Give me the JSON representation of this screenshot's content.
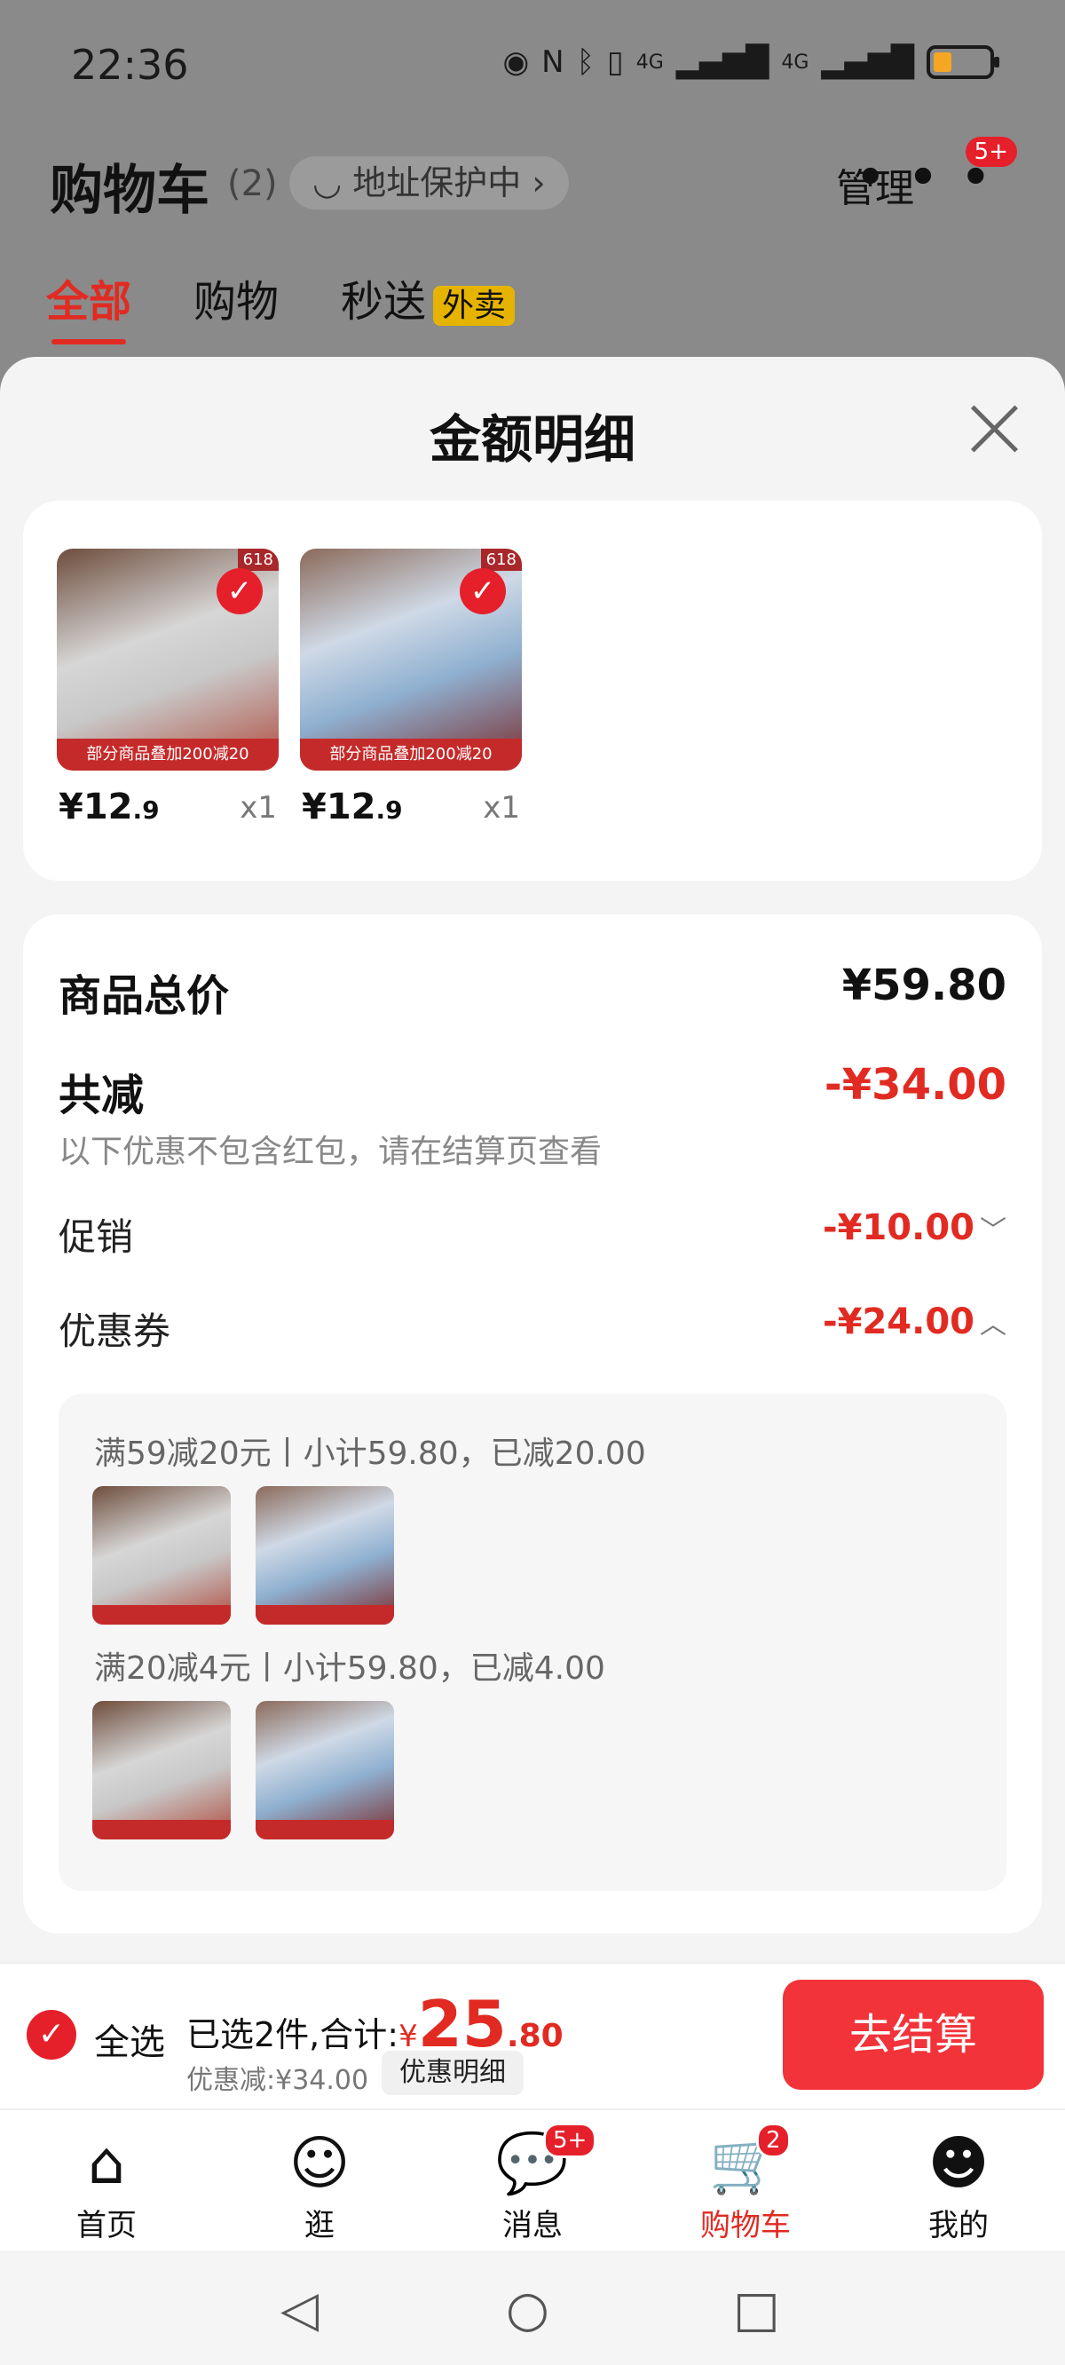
{
  "status_bar": {
    "time": "22:36",
    "network_1": "4G",
    "network_2": "4G",
    "icons": [
      "eye-icon",
      "nfc-icon",
      "bluetooth-icon",
      "vibrate-icon",
      "signal-icon",
      "battery-icon"
    ]
  },
  "header": {
    "title": "购物车",
    "count": "(2)",
    "address_pill": "地址保护中",
    "manage": "管理",
    "more_badge": "5+"
  },
  "tabs": [
    {
      "label": "全部",
      "active": true
    },
    {
      "label": "购物",
      "active": false
    },
    {
      "label": "秒送",
      "tag": "外卖",
      "active": false
    }
  ],
  "sheet": {
    "title": "金额明细",
    "items": [
      {
        "price_int": "¥12",
        "price_dec": ".9",
        "qty": "x1",
        "banner": "部分商品叠加200减20",
        "badge": "618"
      },
      {
        "price_int": "¥12",
        "price_dec": ".9",
        "qty": "x1",
        "banner": "部分商品叠加200减20",
        "badge": "618"
      }
    ],
    "total_label": "商品总价",
    "total_value": "¥59.80",
    "discount_label": "共减",
    "discount_value": "-¥34.00",
    "discount_note": "以下优惠不包含红包，请在结算页查看",
    "promo_label": "促销",
    "promo_value": "-¥10.00",
    "coupon_label": "优惠券",
    "coupon_value": "-¥24.00",
    "coupons": [
      {
        "title": "满59减20元丨小计59.80，已减20.00"
      },
      {
        "title": "满20减4元丨小计59.80，已减4.00"
      }
    ]
  },
  "checkout": {
    "select_all": "全选",
    "summary_prefix": "已选2件,合计:",
    "currency": "¥",
    "amount_int": "25",
    "amount_dec": ".80",
    "discount_text": "优惠减:¥34.00",
    "discount_detail_button": "优惠明细",
    "checkout_button": "去结算"
  },
  "bottom_nav": [
    {
      "label": "首页",
      "icon": "home-icon"
    },
    {
      "label": "逛",
      "icon": "explore-icon"
    },
    {
      "label": "消息",
      "icon": "message-icon",
      "badge": "5+"
    },
    {
      "label": "购物车",
      "icon": "cart-icon",
      "badge": "2",
      "active": true
    },
    {
      "label": "我的",
      "icon": "profile-icon"
    }
  ],
  "colors": {
    "accent": "#e12b22",
    "checkout_button": "#f2333a"
  }
}
